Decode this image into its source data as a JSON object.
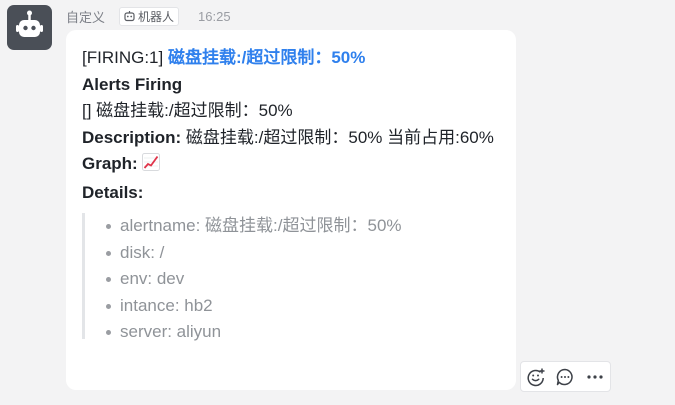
{
  "sender": {
    "name": "自定义",
    "tag_label": "机器人",
    "time": "16:25"
  },
  "message": {
    "title_prefix": "[FIRING:1]",
    "title_link": "磁盘挂载:/超过限制：50%",
    "alerts_heading": "Alerts Firing",
    "alert_line": "[] 磁盘挂载:/超过限制：50%",
    "description_label": "Description:",
    "description_text": "磁盘挂载:/超过限制：50% 当前占用:60%",
    "graph_label": "Graph:",
    "graph_icon": "chart-increasing-icon",
    "details_label": "Details:",
    "details": [
      "alertname: 磁盘挂载:/超过限制：50%",
      "disk: /",
      "env: dev",
      "intance: hb2",
      "server: aliyun"
    ]
  },
  "actions": {
    "icons": [
      "add-reaction-icon",
      "reply-icon",
      "more-icon"
    ]
  },
  "colors": {
    "link": "#2f80ed",
    "avatar_bg": "#4a4f57"
  }
}
